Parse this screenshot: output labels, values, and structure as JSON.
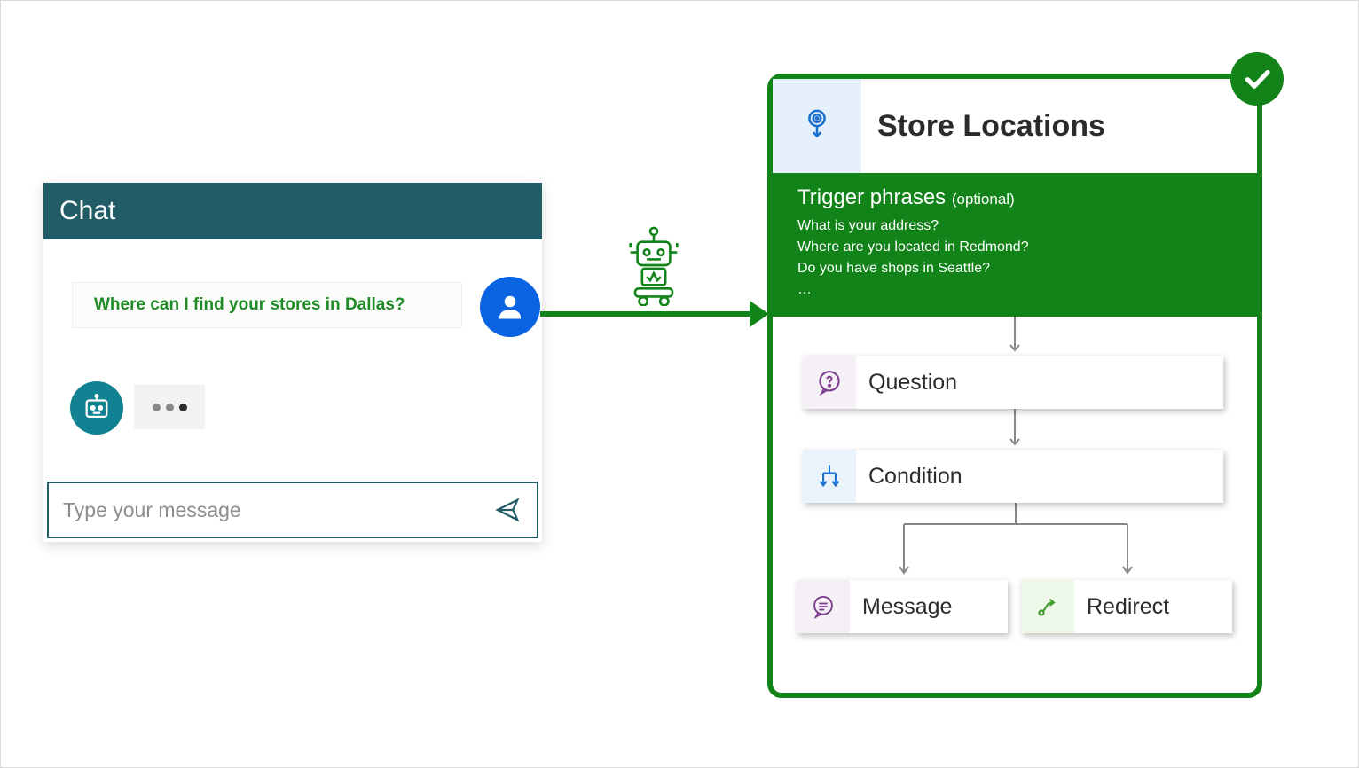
{
  "chat": {
    "title": "Chat",
    "user_message": "Where can I find your stores in Dallas?",
    "input_placeholder": "Type your message"
  },
  "topic": {
    "title": "Store Locations",
    "trigger_title": "Trigger phrases ",
    "trigger_optional": "(optional)",
    "phrases": [
      "What is your address?",
      "Where are you located in Redmond?",
      "Do you have shops in Seattle?",
      "…"
    ],
    "nodes": {
      "question": "Question",
      "condition": "Condition",
      "message": "Message",
      "redirect": "Redirect"
    }
  },
  "icons": {
    "send": "send-icon",
    "user_avatar": "person-icon",
    "bot_avatar": "bot-icon",
    "robot": "robot-icon",
    "topic_trigger": "trigger-icon",
    "question": "question-bubble-icon",
    "condition": "branch-icon",
    "message": "message-bubble-icon",
    "redirect": "redirect-icon",
    "check": "check-icon"
  },
  "colors": {
    "teal": "#225c67",
    "green": "#128318",
    "blue_accent": "#0a63e0"
  }
}
